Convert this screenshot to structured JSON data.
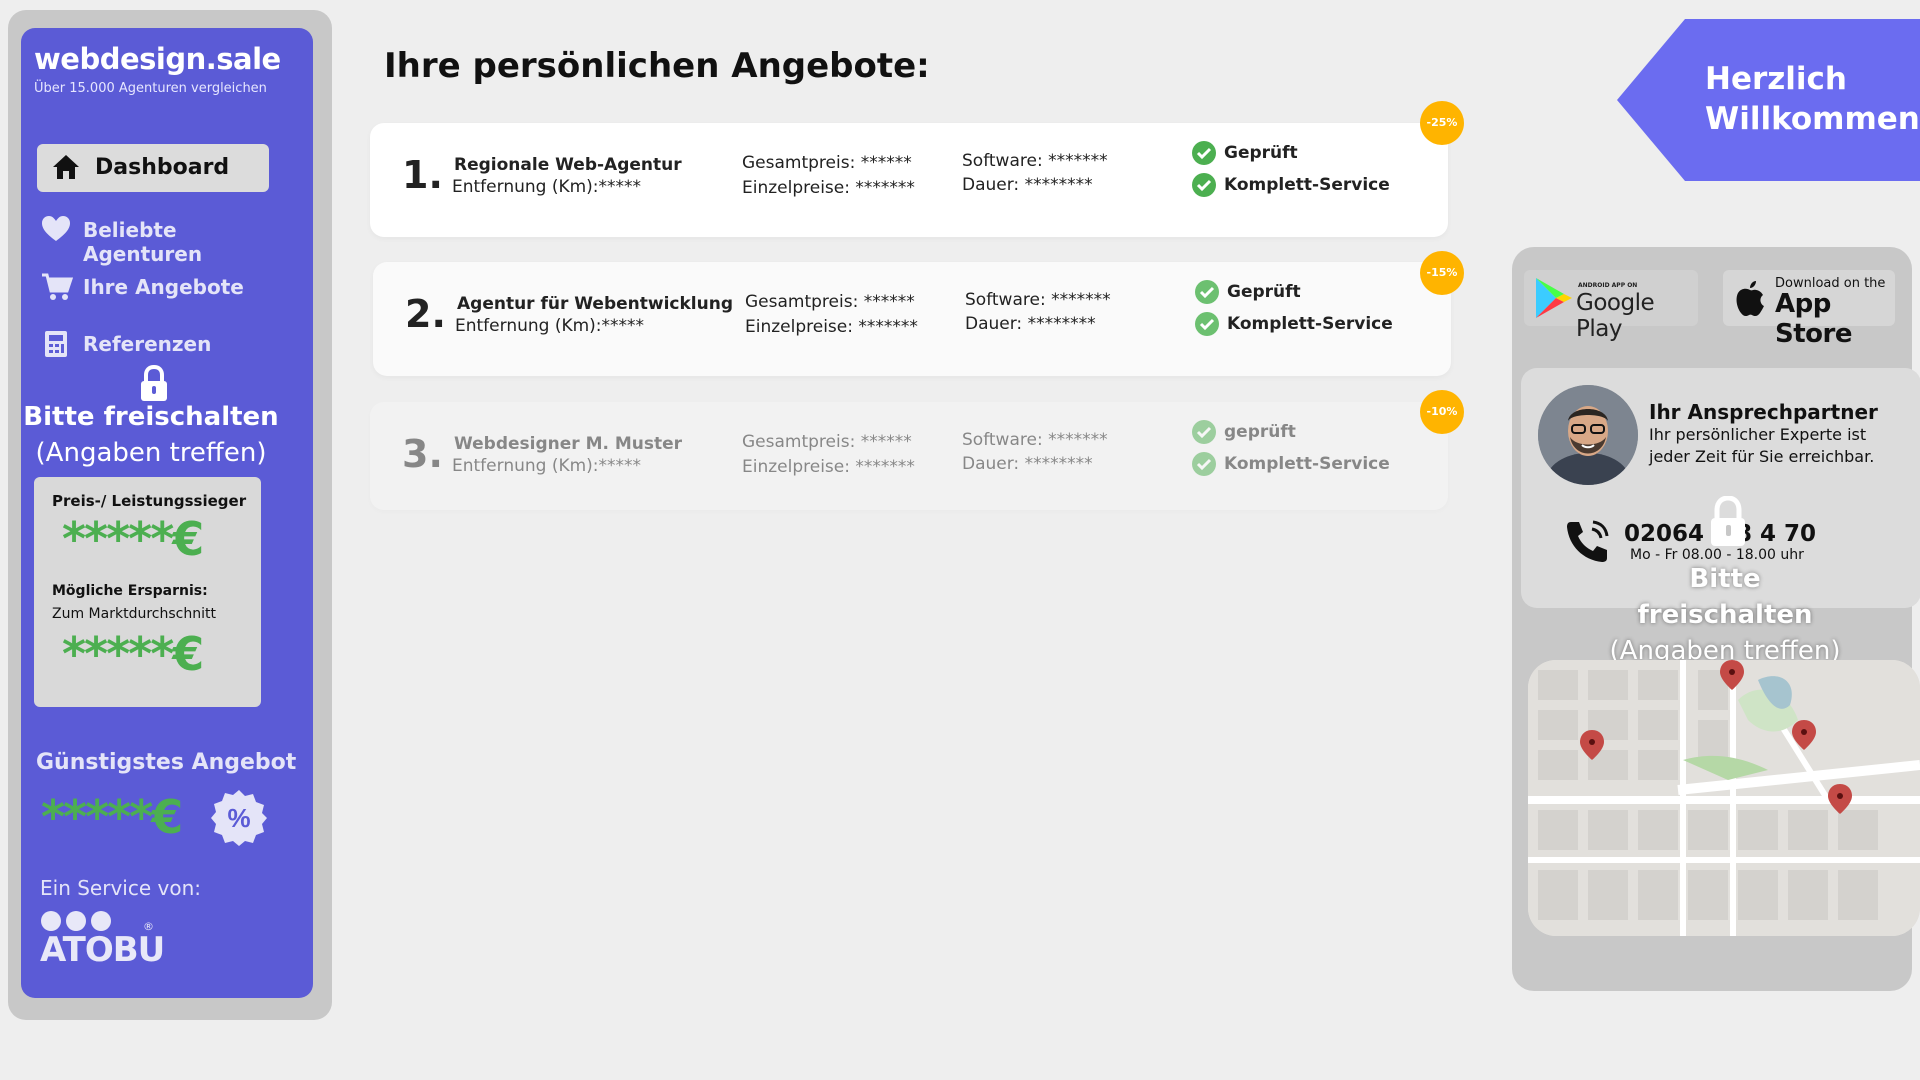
{
  "sidebar": {
    "brand": "webdesign.sale",
    "tagline": "Über 15.000 Agenturen vergleichen",
    "nav": [
      {
        "label": "Dashboard",
        "icon": "home-icon",
        "active": true
      },
      {
        "label": "Beliebte Agenturen",
        "icon": "heart-icon"
      },
      {
        "label": "Ihre Angebote",
        "icon": "cart-icon"
      },
      {
        "label": "Referenzen",
        "icon": "calculator-icon"
      }
    ],
    "unlock": {
      "title": "Bitte freischalten",
      "subtitle": "(Angaben treffen)"
    },
    "winner_box": {
      "title": "Preis-/ Leistungssieger",
      "value": "*****€",
      "savings_title": "Mögliche Ersparnis:",
      "savings_subtitle": "Zum Marktdurchschnitt",
      "savings_value": "*****€"
    },
    "cheapest": {
      "title": "Günstigstes Angebot",
      "value": "*****€",
      "badge": "%"
    },
    "service": {
      "label": "Ein Service von:",
      "logo_text": "ATOBU",
      "logo_mark": "®"
    }
  },
  "main": {
    "title": "Ihre persönlichen Angebote:",
    "offers": [
      {
        "rank": "1.",
        "name": "Regionale Web-Agentur",
        "distance": "Entfernung (Km):*****",
        "total_price": "Gesamtpreis: ******",
        "unit_prices": "Einzelpreise:  *******",
        "software": "Software: *******",
        "duration": "Dauer: ********",
        "check1": "Geprüft",
        "check2": "Komplett-Service",
        "discount": "-25%"
      },
      {
        "rank": "2.",
        "name": "Agentur für Webentwicklung",
        "distance": "Entfernung (Km):*****",
        "total_price": "Gesamtpreis: ******",
        "unit_prices": "Einzelpreise:  *******",
        "software": "Software: *******",
        "duration": "Dauer: ********",
        "check1": "Geprüft",
        "check2": "Komplett-Service",
        "discount": "-15%"
      },
      {
        "rank": "3.",
        "name": "Webdesigner M. Muster",
        "distance": "Entfernung (Km):*****",
        "total_price": "Gesamtpreis: ******",
        "unit_prices": "Einzelpreise:  *******",
        "software": "Software: *******",
        "duration": "Dauer: ********",
        "check1": "geprüft",
        "check2": "Komplett-Service",
        "discount": "-10%"
      }
    ]
  },
  "right": {
    "welcome": {
      "line1": "Herzlich",
      "line2": "Willkommen!"
    },
    "google_play": {
      "small": "ANDROID APP ON",
      "big": "Google Play"
    },
    "app_store": {
      "small": "Download on the",
      "big": "App Store"
    },
    "contact": {
      "title": "Ihr Ansprechpartner",
      "description": "Ihr persönlicher Experte ist jeder Zeit für Sie erreichbar.",
      "phone": "02064 1 8 4 70",
      "hours": "Mo - Fr 08.00 - 18.00 uhr"
    },
    "unlock": {
      "title": "Bitte freischalten",
      "subtitle": "(Angaben treffen)"
    }
  },
  "colors": {
    "sidebar": "#5b5bd6",
    "accent_green": "#4caf50",
    "discount": "#ffb400",
    "welcome": "#6b6cf0",
    "panel_gray": "#c8c8c8"
  }
}
